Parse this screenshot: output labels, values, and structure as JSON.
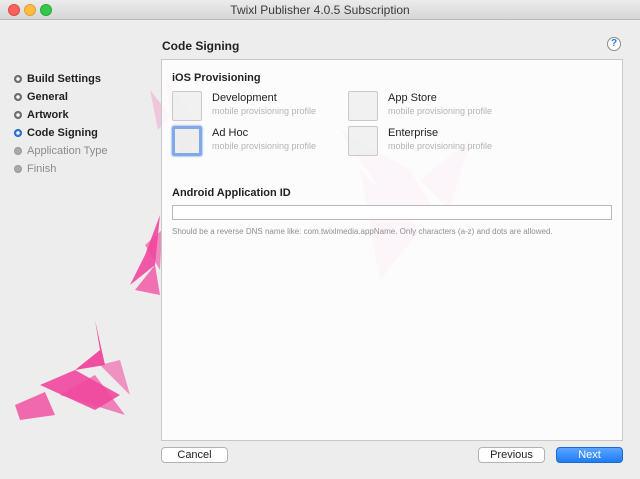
{
  "window": {
    "title": "Twixl Publisher 4.0.5 Subscription"
  },
  "sidebar": {
    "steps": [
      {
        "label": "Build Settings",
        "state": "done"
      },
      {
        "label": "General",
        "state": "done"
      },
      {
        "label": "Artwork",
        "state": "done"
      },
      {
        "label": "Code Signing",
        "state": "current"
      },
      {
        "label": "Application Type",
        "state": "pending"
      },
      {
        "label": "Finish",
        "state": "pending"
      }
    ]
  },
  "header": {
    "title": "Code Signing",
    "help_label": "?"
  },
  "ios": {
    "title": "iOS Provisioning",
    "profiles": [
      {
        "name": "Development",
        "sub": "mobile provisioning profile"
      },
      {
        "name": "App Store",
        "sub": "mobile provisioning profile"
      },
      {
        "name": "Ad Hoc",
        "sub": "mobile provisioning profile",
        "selected": true
      },
      {
        "name": "Enterprise",
        "sub": "mobile provisioning profile"
      }
    ]
  },
  "android": {
    "title": "Android Application ID",
    "value": "",
    "hint": "Should be a reverse DNS name like: com.twixlmedia.appName. Only characters (a-z) and dots are allowed."
  },
  "footer": {
    "cancel": "Cancel",
    "previous": "Previous",
    "next": "Next"
  },
  "colors": {
    "accent": "#2a7be4",
    "bird": "#f0469d"
  }
}
